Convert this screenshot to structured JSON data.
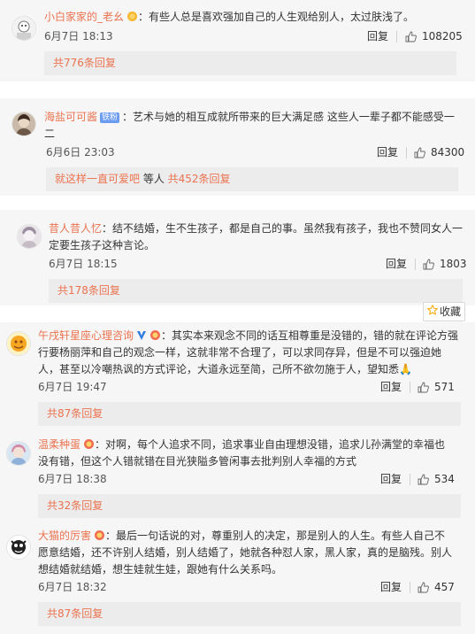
{
  "comments": [
    {
      "user": "小白家家的_老幺",
      "text": "：有些人总是喜欢强加自己的人生观给别人，太过肤浅了。",
      "time": "6月7日 18:13",
      "reply_label": "回复",
      "likes": "108205",
      "replies_label": "共776条回复",
      "icon": "medal-icon"
    },
    {
      "user": "海盐可可酱",
      "badge": "铁粉",
      "text": "：艺术与她的相互成就所带来的巨大满足感 这些人一辈子都不能感受一二",
      "time": "6月6日 23:03",
      "reply_label": "回复",
      "likes": "84300",
      "reply_user": "就这样一直可爱吧",
      "reply_mid": " 等人 ",
      "replies_label": "共452条回复"
    },
    {
      "user": "昔人昔人忆",
      "text": "：结不结婚，生不生孩子，都是自己的事。虽然我有孩子，我也不赞同女人一定要生孩子这种言论。",
      "time": "6月7日 18:15",
      "reply_label": "回复",
      "likes": "1803",
      "replies_label": "共178条回复"
    },
    {
      "user": "午戌轩星座心理咨询",
      "text": "：其实本来观念不同的话互相尊重是没错的，错的就在评论方强行要杨丽萍和自己的观念一样，这就非常不合理了，可以求同存异，但是不可以强迫她人，甚至以冷嘲热讽的方式评论，大道永远至简，己所不欲勿施于人，望知悉🙏",
      "time": "6月7日 19:47",
      "reply_label": "回复",
      "likes": "571",
      "replies_label": "共87条回复"
    },
    {
      "user": "温柔种蛋",
      "text": "：对啊，每个人追求不同，追求事业自由理想没错，追求儿孙满堂的幸福也没有错，但这个人错就错在目光狭隘多管闲事去批判别人幸福的方式",
      "time": "6月7日 18:38",
      "reply_label": "回复",
      "likes": "534",
      "replies_label": "共32条回复"
    },
    {
      "user": "大猫的厉害",
      "text": "：最后一句话说的对，尊重别人的决定，那是别人的人生。有些人自己不愿意结婚，还不许别人结婚，别人结婚了，她就各种怼人家，黑人家，真的是脑残。别人想结婚就结婚，想生娃就生娃，跟她有什么关系吗。",
      "time": "6月7日 18:32",
      "reply_label": "回复",
      "likes": "457",
      "replies_label": "共87条回复"
    }
  ],
  "favorite_label": "收藏",
  "colors": {
    "username": "#eb7350",
    "card_bg": "#f6f6f6",
    "subbox_bg": "#ececec"
  }
}
